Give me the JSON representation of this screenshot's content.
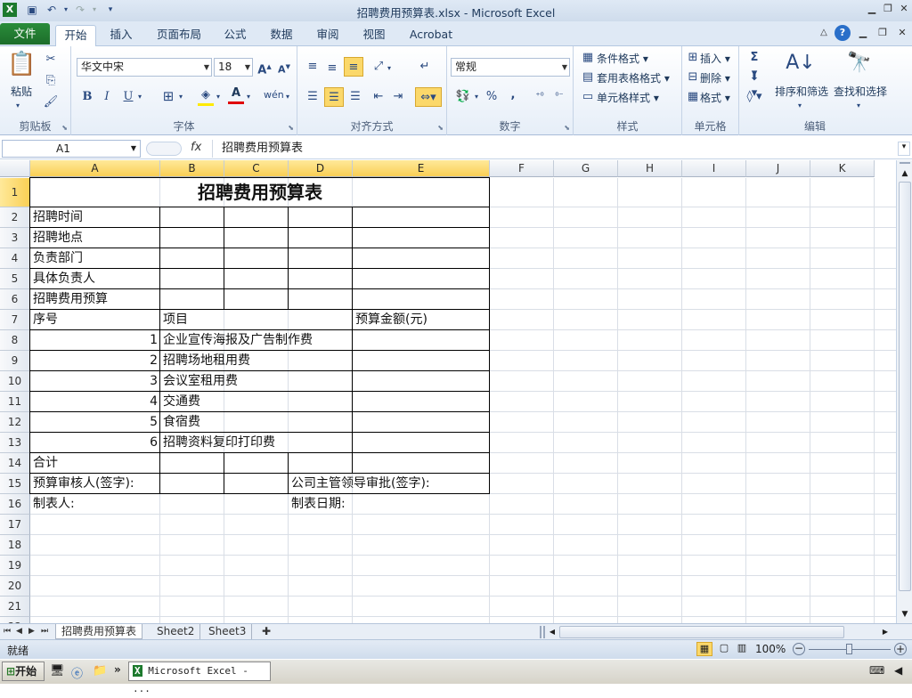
{
  "window": {
    "title": "招聘费用预算表.xlsx  -  Microsoft Excel"
  },
  "tabs": [
    "文件",
    "开始",
    "插入",
    "页面布局",
    "公式",
    "数据",
    "审阅",
    "视图",
    "Acrobat"
  ],
  "ribbon": {
    "clipboard": {
      "label": "剪贴板",
      "paste": "粘贴"
    },
    "font": {
      "label": "字体",
      "name": "华文中宋",
      "size": "18",
      "bold": "B",
      "italic": "I",
      "underline": "U"
    },
    "alignment": {
      "label": "对齐方式"
    },
    "number": {
      "label": "数字",
      "format": "常规",
      "percent": "%",
      "comma": ","
    },
    "styles": {
      "label": "样式",
      "conditional": "条件格式",
      "table": "套用表格格式",
      "cell": "单元格样式"
    },
    "cells": {
      "label": "单元格",
      "insert": "插入",
      "delete": "删除",
      "format": "格式"
    },
    "editing": {
      "label": "编辑",
      "sort": "排序和筛选",
      "find": "查找和选择"
    }
  },
  "formula_bar": {
    "name_box": "A1",
    "fx": "fx",
    "content": "招聘费用预算表"
  },
  "columns": [
    "A",
    "B",
    "C",
    "D",
    "E",
    "F",
    "G",
    "H",
    "I",
    "J",
    "K"
  ],
  "rows": [
    "1",
    "2",
    "3",
    "4",
    "5",
    "6",
    "7",
    "8",
    "9",
    "10",
    "11",
    "12",
    "13",
    "14",
    "15",
    "16",
    "17",
    "18",
    "19",
    "20",
    "21",
    "22",
    "23"
  ],
  "cells": {
    "title": "招聘费用预算表",
    "a2": "招聘时间",
    "a3": "招聘地点",
    "a4": "负责部门",
    "a5": "具体负责人",
    "a6": "招聘费用预算",
    "a7": "序号",
    "b7": "项目",
    "e7": "预算金额(元)",
    "n1": "1",
    "n2": "2",
    "n3": "3",
    "n4": "4",
    "n5": "5",
    "n6": "6",
    "i1": "企业宣传海报及广告制作费",
    "i2": "招聘场地租用费",
    "i3": "会议室租用费",
    "i4": "交通费",
    "i5": "食宿费",
    "i6": "招聘资料复印打印费",
    "a14": "合计",
    "a15": "预算审核人(签字):",
    "d15": "公司主管领导审批(签字):",
    "a16": "制表人:",
    "d16": "制表日期:"
  },
  "sheets": [
    "招聘费用预算表",
    "Sheet2",
    "Sheet3"
  ],
  "status": {
    "ready": "就绪",
    "zoom": "100%"
  },
  "taskbar": {
    "start": "开始",
    "app": "Microsoft Excel - ..."
  }
}
